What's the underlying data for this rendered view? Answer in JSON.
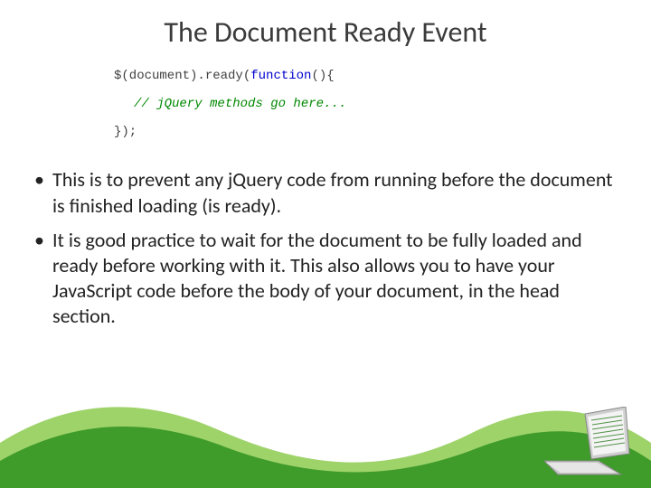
{
  "title": "The Document Ready Event",
  "code": {
    "line1_prefix": "$(document).ready(",
    "line1_kw": "function",
    "line1_suffix": "(){",
    "comment": "// jQuery methods go here...",
    "line3": "});"
  },
  "bullets": [
    "This is to prevent any jQuery code from running before the document is finished loading (is ready).",
    "It is good practice to wait for the document to be fully loaded and ready before working with it. This also allows you to have your JavaScript code before the body of your document, in the head section."
  ],
  "colors": {
    "wave_light": "#9ed36a",
    "wave_dark": "#3f9b2a"
  }
}
